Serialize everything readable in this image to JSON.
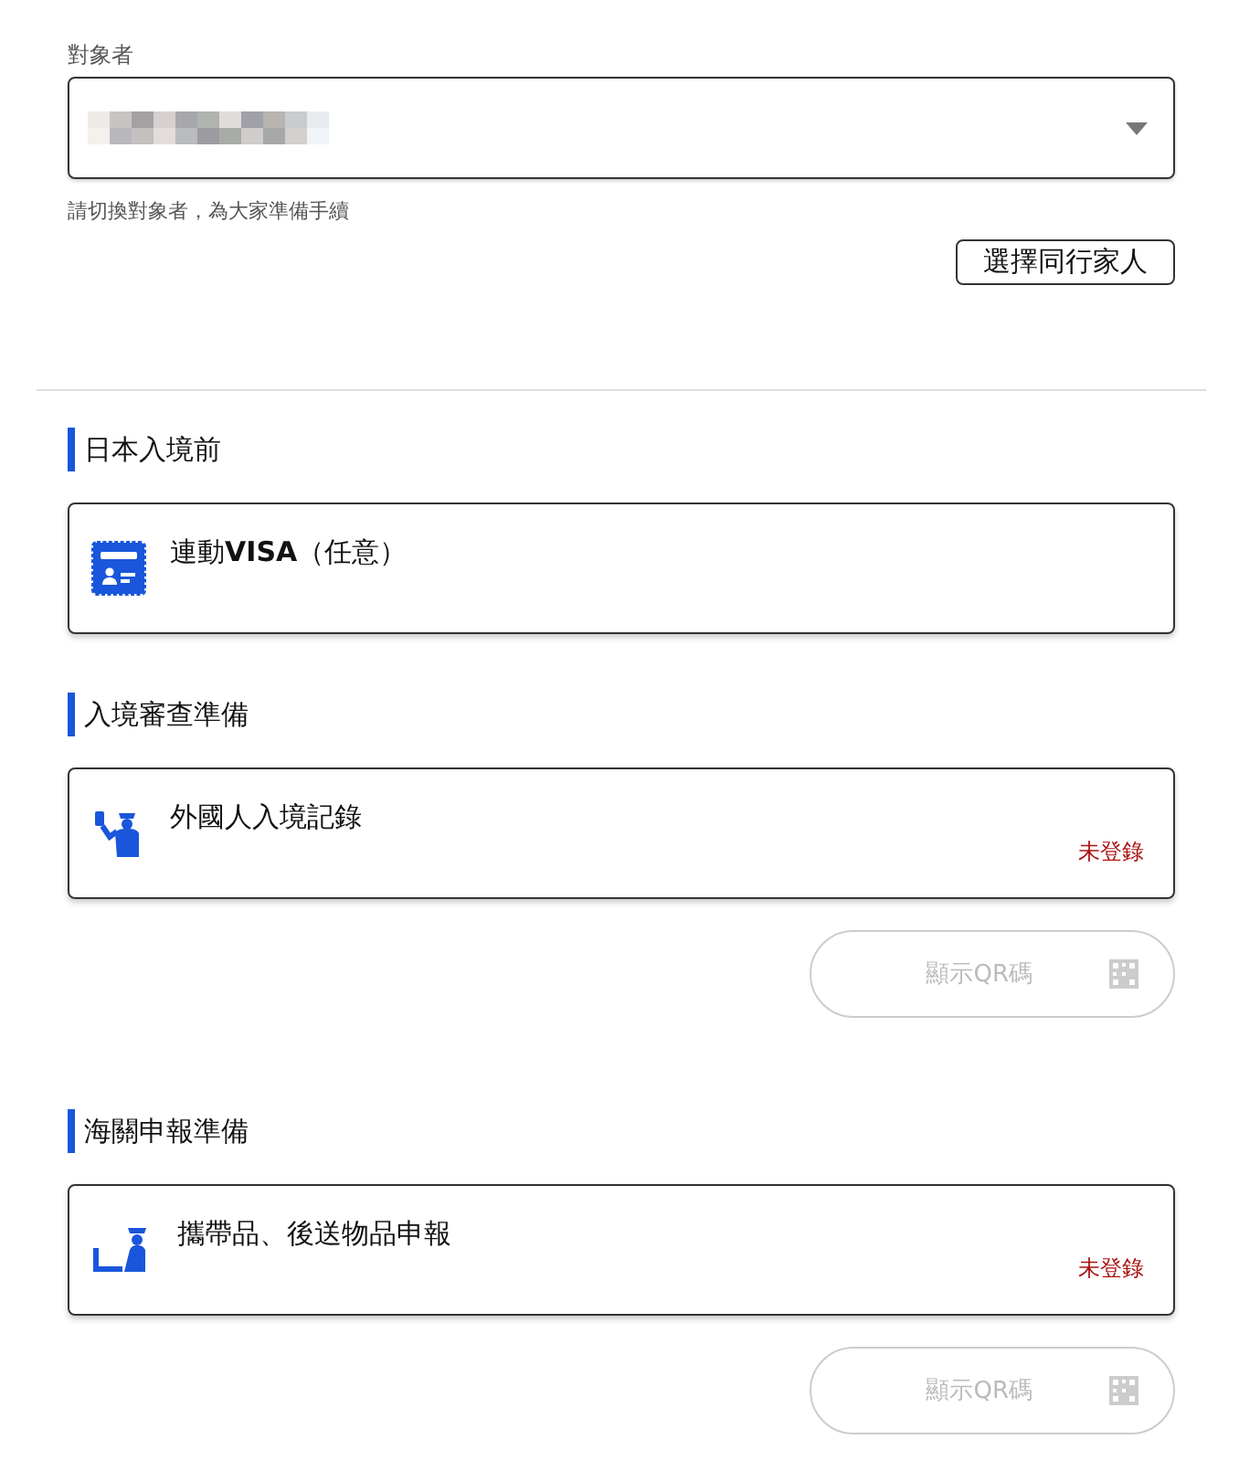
{
  "target": {
    "label": "對象者",
    "hint": "請切換對象者，為大家準備手續",
    "family_button": "選擇同行家人"
  },
  "sections": [
    {
      "title": "日本入境前",
      "card": {
        "kind": "visa",
        "title": "連動**VISA**（任意）"
      }
    },
    {
      "title": "入境審查準備",
      "card": {
        "kind": "officer",
        "title": "外國人入境記錄",
        "status": "未登錄"
      },
      "qr_button": {
        "label": "顯示QR碼",
        "disabled": true
      }
    },
    {
      "title": "海關申報準備",
      "card": {
        "kind": "customs",
        "title": "攜帶品、後送物品申報",
        "status": "未登錄"
      },
      "qr_button": {
        "label": "顯示QR碼",
        "disabled": true
      }
    }
  ]
}
